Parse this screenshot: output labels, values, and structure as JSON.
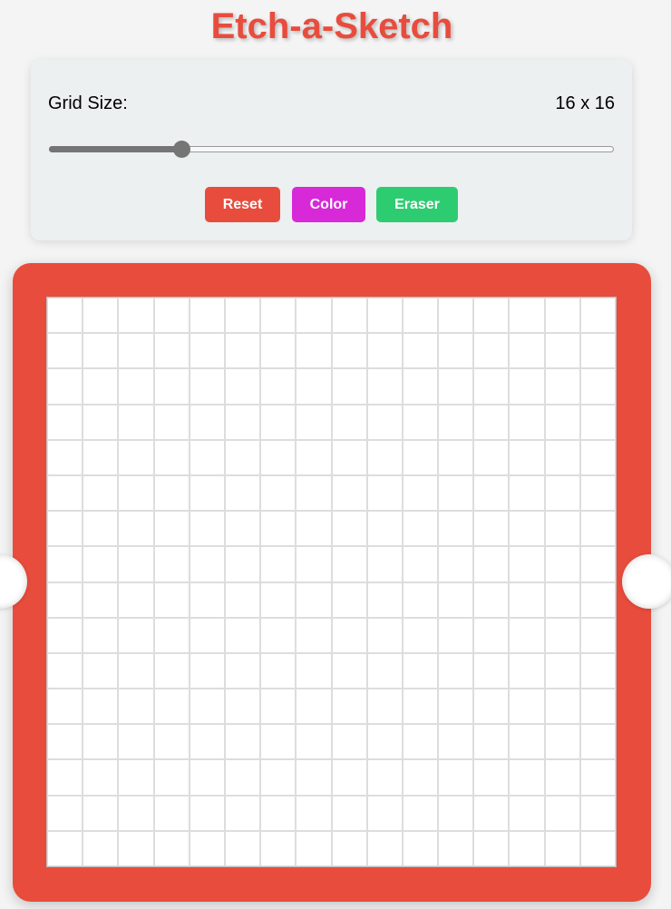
{
  "app": {
    "title": "Etch-a-Sketch"
  },
  "controls": {
    "grid_size_label": "Grid Size:",
    "grid_size_value": "16 x 16",
    "slider": {
      "value": 16,
      "min": 2,
      "max": 64
    },
    "buttons": {
      "reset_label": "Reset",
      "color_label": "Color",
      "eraser_label": "Eraser"
    }
  },
  "board": {
    "rows": 16,
    "columns": 16
  },
  "colors": {
    "accent_red": "#e84c3d",
    "color_button": "#d729d7",
    "eraser_button": "#2ecc71",
    "panel_background": "#ecf0f1",
    "page_background": "#f4f4f4",
    "grid_line": "#dddddd"
  }
}
